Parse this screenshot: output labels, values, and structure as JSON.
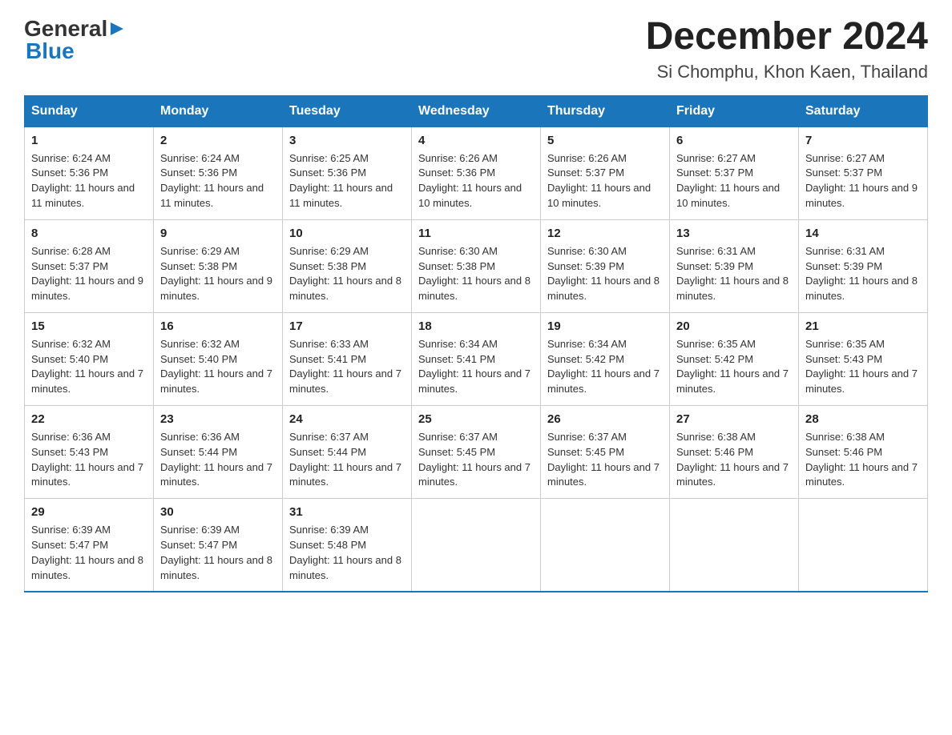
{
  "header": {
    "logo_general": "General",
    "logo_blue": "Blue",
    "month_year": "December 2024",
    "location": "Si Chomphu, Khon Kaen, Thailand"
  },
  "days_of_week": [
    "Sunday",
    "Monday",
    "Tuesday",
    "Wednesday",
    "Thursday",
    "Friday",
    "Saturday"
  ],
  "weeks": [
    [
      {
        "day": "1",
        "sunrise": "6:24 AM",
        "sunset": "5:36 PM",
        "daylight": "11 hours and 11 minutes."
      },
      {
        "day": "2",
        "sunrise": "6:24 AM",
        "sunset": "5:36 PM",
        "daylight": "11 hours and 11 minutes."
      },
      {
        "day": "3",
        "sunrise": "6:25 AM",
        "sunset": "5:36 PM",
        "daylight": "11 hours and 11 minutes."
      },
      {
        "day": "4",
        "sunrise": "6:26 AM",
        "sunset": "5:36 PM",
        "daylight": "11 hours and 10 minutes."
      },
      {
        "day": "5",
        "sunrise": "6:26 AM",
        "sunset": "5:37 PM",
        "daylight": "11 hours and 10 minutes."
      },
      {
        "day": "6",
        "sunrise": "6:27 AM",
        "sunset": "5:37 PM",
        "daylight": "11 hours and 10 minutes."
      },
      {
        "day": "7",
        "sunrise": "6:27 AM",
        "sunset": "5:37 PM",
        "daylight": "11 hours and 9 minutes."
      }
    ],
    [
      {
        "day": "8",
        "sunrise": "6:28 AM",
        "sunset": "5:37 PM",
        "daylight": "11 hours and 9 minutes."
      },
      {
        "day": "9",
        "sunrise": "6:29 AM",
        "sunset": "5:38 PM",
        "daylight": "11 hours and 9 minutes."
      },
      {
        "day": "10",
        "sunrise": "6:29 AM",
        "sunset": "5:38 PM",
        "daylight": "11 hours and 8 minutes."
      },
      {
        "day": "11",
        "sunrise": "6:30 AM",
        "sunset": "5:38 PM",
        "daylight": "11 hours and 8 minutes."
      },
      {
        "day": "12",
        "sunrise": "6:30 AM",
        "sunset": "5:39 PM",
        "daylight": "11 hours and 8 minutes."
      },
      {
        "day": "13",
        "sunrise": "6:31 AM",
        "sunset": "5:39 PM",
        "daylight": "11 hours and 8 minutes."
      },
      {
        "day": "14",
        "sunrise": "6:31 AM",
        "sunset": "5:39 PM",
        "daylight": "11 hours and 8 minutes."
      }
    ],
    [
      {
        "day": "15",
        "sunrise": "6:32 AM",
        "sunset": "5:40 PM",
        "daylight": "11 hours and 7 minutes."
      },
      {
        "day": "16",
        "sunrise": "6:32 AM",
        "sunset": "5:40 PM",
        "daylight": "11 hours and 7 minutes."
      },
      {
        "day": "17",
        "sunrise": "6:33 AM",
        "sunset": "5:41 PM",
        "daylight": "11 hours and 7 minutes."
      },
      {
        "day": "18",
        "sunrise": "6:34 AM",
        "sunset": "5:41 PM",
        "daylight": "11 hours and 7 minutes."
      },
      {
        "day": "19",
        "sunrise": "6:34 AM",
        "sunset": "5:42 PM",
        "daylight": "11 hours and 7 minutes."
      },
      {
        "day": "20",
        "sunrise": "6:35 AM",
        "sunset": "5:42 PM",
        "daylight": "11 hours and 7 minutes."
      },
      {
        "day": "21",
        "sunrise": "6:35 AM",
        "sunset": "5:43 PM",
        "daylight": "11 hours and 7 minutes."
      }
    ],
    [
      {
        "day": "22",
        "sunrise": "6:36 AM",
        "sunset": "5:43 PM",
        "daylight": "11 hours and 7 minutes."
      },
      {
        "day": "23",
        "sunrise": "6:36 AM",
        "sunset": "5:44 PM",
        "daylight": "11 hours and 7 minutes."
      },
      {
        "day": "24",
        "sunrise": "6:37 AM",
        "sunset": "5:44 PM",
        "daylight": "11 hours and 7 minutes."
      },
      {
        "day": "25",
        "sunrise": "6:37 AM",
        "sunset": "5:45 PM",
        "daylight": "11 hours and 7 minutes."
      },
      {
        "day": "26",
        "sunrise": "6:37 AM",
        "sunset": "5:45 PM",
        "daylight": "11 hours and 7 minutes."
      },
      {
        "day": "27",
        "sunrise": "6:38 AM",
        "sunset": "5:46 PM",
        "daylight": "11 hours and 7 minutes."
      },
      {
        "day": "28",
        "sunrise": "6:38 AM",
        "sunset": "5:46 PM",
        "daylight": "11 hours and 7 minutes."
      }
    ],
    [
      {
        "day": "29",
        "sunrise": "6:39 AM",
        "sunset": "5:47 PM",
        "daylight": "11 hours and 8 minutes."
      },
      {
        "day": "30",
        "sunrise": "6:39 AM",
        "sunset": "5:47 PM",
        "daylight": "11 hours and 8 minutes."
      },
      {
        "day": "31",
        "sunrise": "6:39 AM",
        "sunset": "5:48 PM",
        "daylight": "11 hours and 8 minutes."
      },
      null,
      null,
      null,
      null
    ]
  ],
  "labels": {
    "sunrise_prefix": "Sunrise: ",
    "sunset_prefix": "Sunset: ",
    "daylight_prefix": "Daylight: "
  }
}
